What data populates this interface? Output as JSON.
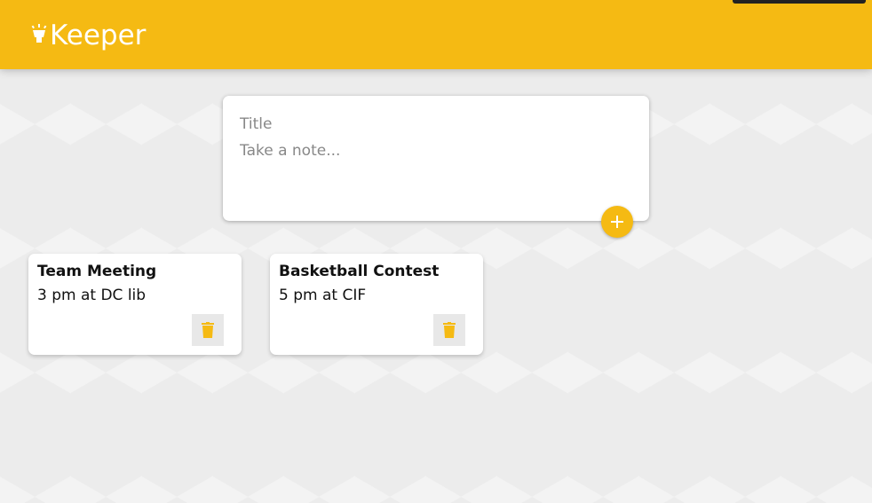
{
  "header": {
    "app_title": "Keeper"
  },
  "create_note": {
    "title_placeholder": "Title",
    "content_placeholder": "Take a note...",
    "add_icon": "plus-icon"
  },
  "notes": [
    {
      "title": "Team Meeting",
      "content": "3 pm at DC lib",
      "delete_icon": "trash-icon"
    },
    {
      "title": "Basketball Contest",
      "content": "5 pm at CIF",
      "delete_icon": "trash-icon"
    }
  ],
  "colors": {
    "accent": "#f5ba13",
    "background": "#eeeeee",
    "card": "#ffffff"
  }
}
